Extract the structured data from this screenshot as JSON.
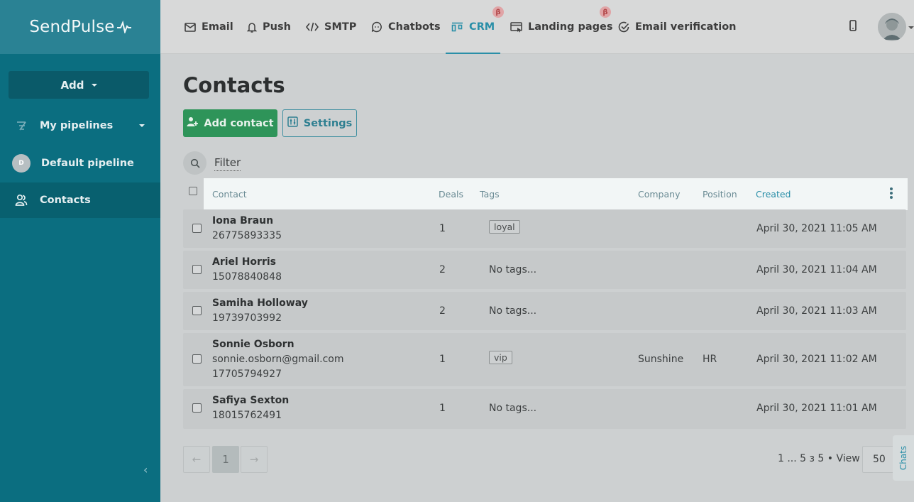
{
  "app": {
    "logo_text": "SendPulse"
  },
  "nav": {
    "items": [
      {
        "label": "Email",
        "icon": "envelope-icon"
      },
      {
        "label": "Push",
        "icon": "bell-icon"
      },
      {
        "label": "SMTP",
        "icon": "code-icon"
      },
      {
        "label": "Chatbots",
        "icon": "chat-icon"
      },
      {
        "label": "CRM",
        "icon": "kanban-icon",
        "active": true,
        "badge": "β"
      },
      {
        "label": "Landing pages",
        "icon": "landing-icon",
        "badge": "β"
      },
      {
        "label": "Email verification",
        "icon": "check-circle-icon"
      }
    ]
  },
  "sidebar": {
    "add_label": "Add",
    "items": [
      {
        "label": "My pipelines",
        "icon": "pipeline-icon"
      },
      {
        "label": "Default pipeline",
        "avatar_letter": "D"
      },
      {
        "label": "Contacts",
        "icon": "contacts-icon",
        "active": true
      }
    ]
  },
  "main": {
    "title": "Contacts",
    "add_contact_label": "Add contact",
    "settings_label": "Settings",
    "filter_label": "Filter",
    "columns": [
      "Contact",
      "Deals",
      "Tags",
      "Company",
      "Position",
      "Created"
    ],
    "rows": [
      {
        "name": "Iona Braun",
        "lines": [
          "26775893335"
        ],
        "deals": "1",
        "tag": "loyal",
        "company": "",
        "position": "",
        "created": "April 30, 2021 11:05 AM"
      },
      {
        "name": "Ariel Horris",
        "lines": [
          "15078840848"
        ],
        "deals": "2",
        "tag": "",
        "no_tags": "No tags...",
        "company": "",
        "position": "",
        "created": "April 30, 2021 11:04 AM"
      },
      {
        "name": "Samiha Holloway",
        "lines": [
          "19739703992"
        ],
        "deals": "2",
        "tag": "",
        "no_tags": "No tags...",
        "company": "",
        "position": "",
        "created": "April 30, 2021 11:03 AM"
      },
      {
        "name": "Sonnie Osborn",
        "lines": [
          "sonnie.osborn@gmail.com",
          "17705794927"
        ],
        "deals": "1",
        "tag": "vip",
        "company": "Sunshine",
        "position": "HR",
        "created": "April 30, 2021 11:02 AM"
      },
      {
        "name": "Safiya Sexton",
        "lines": [
          "18015762491"
        ],
        "deals": "1",
        "tag": "",
        "no_tags": "No tags...",
        "company": "",
        "position": "",
        "created": "April 30, 2021 11:01 AM"
      }
    ]
  },
  "pagination": {
    "prev": "←",
    "current": "1",
    "next": "→",
    "info": "1 ... 5 з 5",
    "view_label": "View",
    "per_page": "50"
  },
  "chats_label": "Chats",
  "colors": {
    "sidebar": "#0b6e80",
    "accent": "#2a8fa8",
    "add_contact": "#2e9459",
    "beta_badge": "#e0a4a6"
  }
}
